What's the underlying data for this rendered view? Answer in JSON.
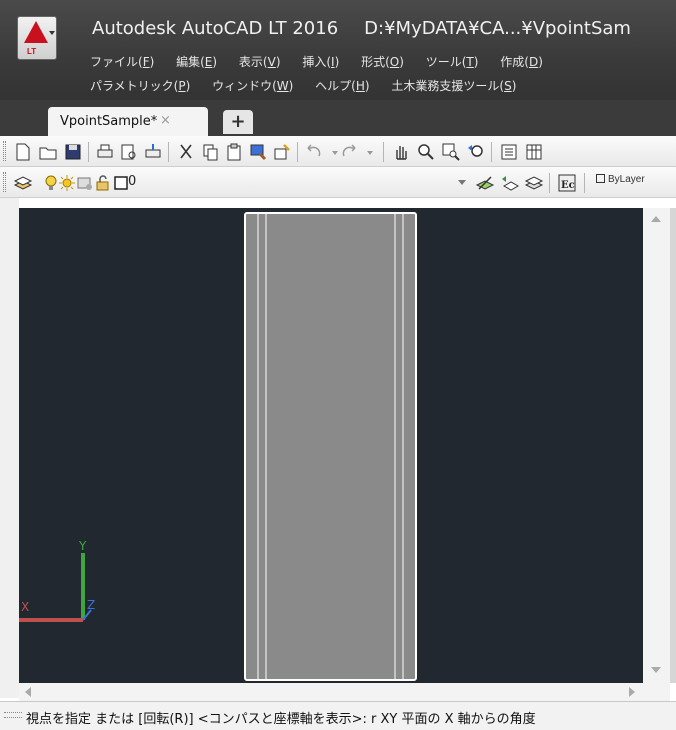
{
  "app": {
    "title": "Autodesk AutoCAD LT 2016",
    "path": "D:¥MyDATA¥CA...¥VpointSam",
    "logo_badge": "LT"
  },
  "menu": {
    "row1": [
      {
        "label": "ファイル(",
        "key": "F",
        "tail": ")"
      },
      {
        "label": "編集(",
        "key": "E",
        "tail": ")"
      },
      {
        "label": "表示(",
        "key": "V",
        "tail": ")"
      },
      {
        "label": "挿入(",
        "key": "I",
        "tail": ")"
      },
      {
        "label": "形式(",
        "key": "O",
        "tail": ")"
      },
      {
        "label": "ツール(",
        "key": "T",
        "tail": ")"
      },
      {
        "label": "作成(",
        "key": "D",
        "tail": ")"
      }
    ],
    "row2": [
      {
        "label": "パラメトリック(",
        "key": "P",
        "tail": ")"
      },
      {
        "label": "ウィンドウ(",
        "key": "W",
        "tail": ")"
      },
      {
        "label": "ヘルプ(",
        "key": "H",
        "tail": ")"
      },
      {
        "label": "土木業務支援ツール(",
        "key": "S",
        "tail": ")"
      }
    ]
  },
  "tabs": {
    "active_label": "VpointSample*",
    "close_glyph": "×",
    "new_tab_glyph": "+"
  },
  "layer_bar": {
    "current_layer": "0",
    "linetype": "ByLayer"
  },
  "viewport": {
    "ucs_y": "Y",
    "ucs_x": "X",
    "ucs_z": "Z",
    "colors": {
      "background": "#212830",
      "y_axis": "#3fa63f",
      "x_axis": "#c0504d",
      "z_axis": "#3d6fd8",
      "outline": "#ffffff",
      "fill": "#8a8a8a"
    }
  },
  "command_line": {
    "text": "視点を指定 または [回転(R)] <コンパスと座標軸を表示>: r XY 平面の X 軸からの角度"
  }
}
